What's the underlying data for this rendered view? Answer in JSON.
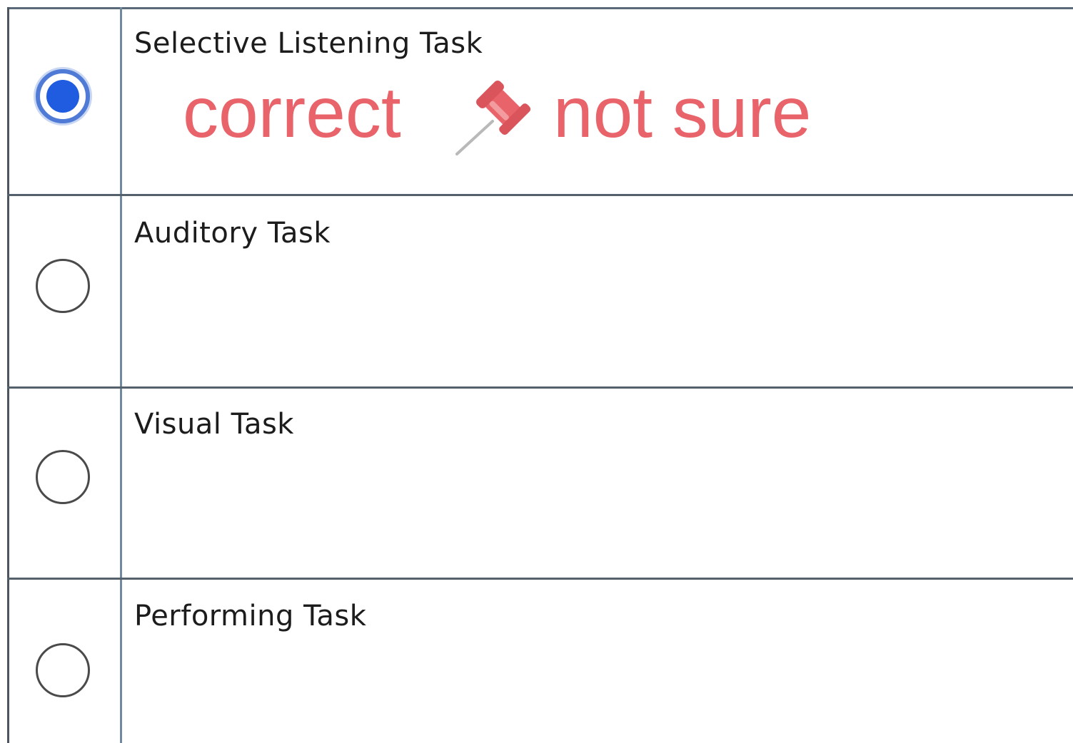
{
  "options": [
    {
      "label": "Selective Listening Task",
      "selected": true
    },
    {
      "label": "Auditory Task",
      "selected": false
    },
    {
      "label": "Visual Task",
      "selected": false
    },
    {
      "label": "Performing Task",
      "selected": false
    }
  ],
  "annotation": {
    "left_text": "correct",
    "right_text": "not sure",
    "color": "#e8636a",
    "icon": "pushpin-icon"
  },
  "colors": {
    "radio_selected": "#1f5ce0",
    "divider": "#54606b"
  }
}
